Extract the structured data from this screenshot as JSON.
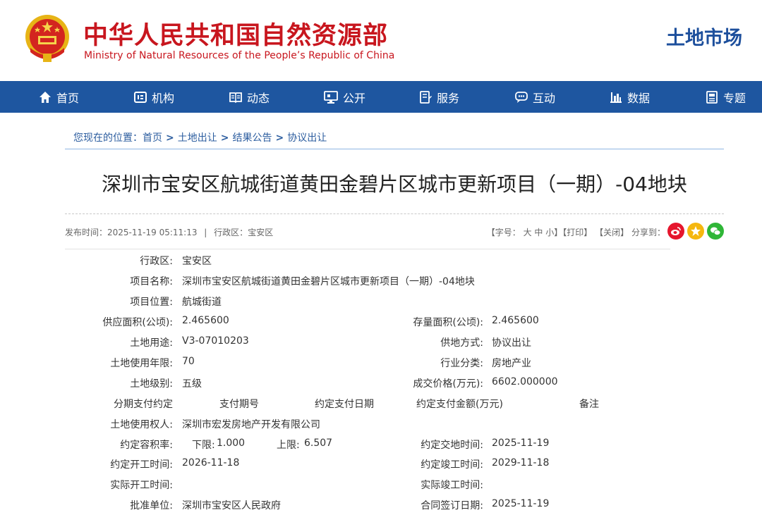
{
  "header": {
    "title_cn": "中华人民共和国自然资源部",
    "title_en": "Ministry of Natural Resources of the People’s Republic of China",
    "site_name": "土地市场",
    "brand_red": "#c8161e",
    "brand_blue": "#1e56a0"
  },
  "nav": [
    {
      "label": "首页",
      "icon": "home-icon"
    },
    {
      "label": "机构",
      "icon": "org-icon"
    },
    {
      "label": "动态",
      "icon": "book-icon"
    },
    {
      "label": "公开",
      "icon": "monitor-icon"
    },
    {
      "label": "服务",
      "icon": "service-icon"
    },
    {
      "label": "互动",
      "icon": "chat-icon"
    },
    {
      "label": "数据",
      "icon": "bar-chart-icon"
    },
    {
      "label": "专题",
      "icon": "topic-icon"
    }
  ],
  "breadcrumb": {
    "prefix": "您现在的位置：",
    "items": [
      "首页",
      "土地出让",
      "结果公告",
      "协议出让"
    ]
  },
  "article": {
    "title": "深圳市宝安区航城街道黄田金碧片区城市更新项目（一期）-04地块",
    "publish_label": "发布时间：",
    "publish_time": "2025-11-19 05:11:13",
    "separator": "|",
    "region_label": "行政区：",
    "region": "宝安区"
  },
  "tools": {
    "font_label": "【字号：",
    "font_large": "大",
    "font_medium": "中",
    "font_small": "小",
    "font_close": "】",
    "print": "【打印】",
    "close": "【关闭】",
    "share_label": "分享到："
  },
  "share": [
    {
      "name": "weibo-icon",
      "color": "#e6162d"
    },
    {
      "name": "qzone-icon",
      "color": "#f5b70f"
    },
    {
      "name": "wechat-icon",
      "color": "#2fb637"
    }
  ],
  "details": {
    "district_label": "行政区:",
    "district": "宝安区",
    "project_name_label": "项目名称:",
    "project_name": "深圳市宝安区航城街道黄田金碧片区城市更新项目（一期）-04地块",
    "location_label": "项目位置:",
    "location": "航城街道",
    "supply_area_label": "供应面积(公顷):",
    "supply_area": "2.465600",
    "stock_area_label": "存量面积(公顷):",
    "stock_area": "2.465600",
    "land_use_label": "土地用途:",
    "land_use": "V3-07010203",
    "supply_method_label": "供地方式:",
    "supply_method": "协议出让",
    "term_label": "土地使用年限:",
    "term": "70",
    "industry_label": "行业分类:",
    "industry": "房地产业",
    "grade_label": "土地级别:",
    "grade": "五级",
    "price_label": "成交价格(万元):",
    "price": "6602.000000",
    "installment_label": "分期支付约定",
    "installment_cols": [
      "支付期号",
      "约定支付日期",
      "约定支付金额(万元)",
      "备注"
    ],
    "holder_label": "土地使用权人:",
    "holder": "深圳市宏发房地产开发有限公司",
    "far_label": "约定容积率:",
    "far_min_label": "下限:",
    "far_min": "1.000",
    "far_max_label": "上限:",
    "far_max": "6.507",
    "handover_label": "约定交地时间:",
    "handover": "2025-11-19",
    "start_label": "约定开工时间:",
    "start": "2026-11-18",
    "finish_label": "约定竣工时间:",
    "finish": "2029-11-18",
    "actual_start_label": "实际开工时间:",
    "actual_start": "",
    "actual_finish_label": "实际竣工时间:",
    "actual_finish": "",
    "approver_label": "批准单位:",
    "approver": "深圳市宝安区人民政府",
    "contract_label": "合同签订日期:",
    "contract": "2025-11-19"
  }
}
